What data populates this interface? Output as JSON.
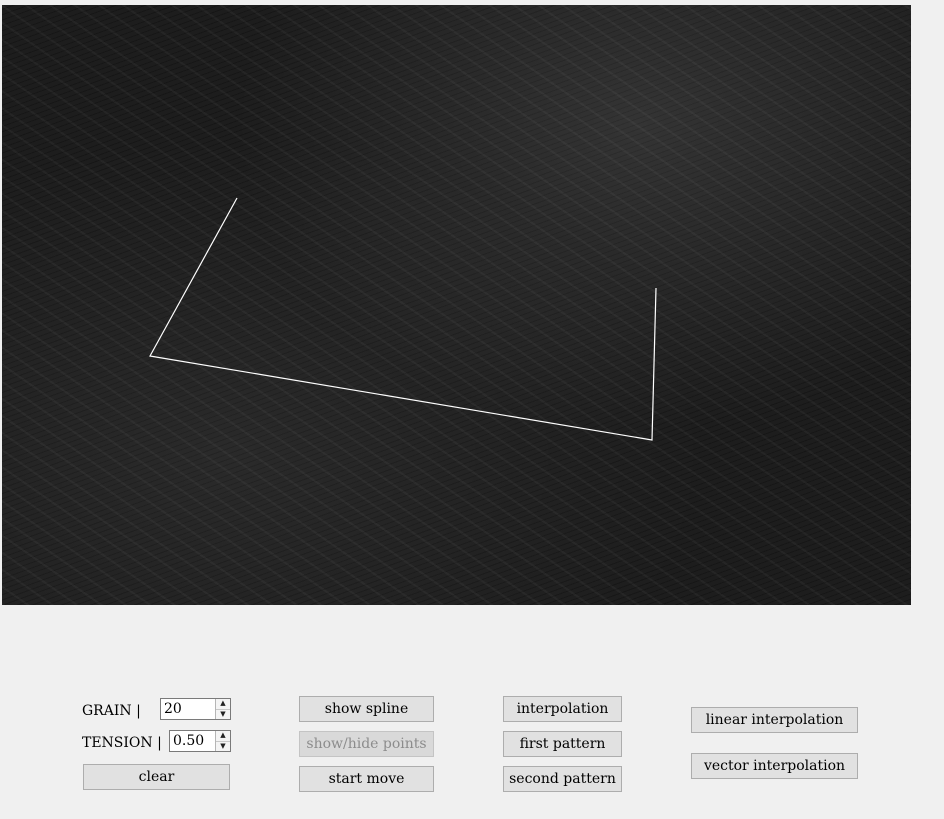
{
  "canvas": {
    "stroke_color": "#ffffff",
    "background_color": "#1d1d1d"
  },
  "controls": {
    "grain": {
      "label": "GRAIN  |",
      "value": "20"
    },
    "tension": {
      "label": "TENSION  |",
      "value": "0.50"
    },
    "spin_up_icon": "▲",
    "spin_down_icon": "▼",
    "clear_label": "clear",
    "show_spline_label": "show spline",
    "show_hide_points_label": "show/hide points",
    "start_move_label": "start move",
    "interpolation_label": "interpolation",
    "first_pattern_label": "first pattern",
    "second_pattern_label": "second pattern",
    "linear_interpolation_label": "linear interpolation",
    "vector_interpolation_label": "vector interpolation"
  }
}
